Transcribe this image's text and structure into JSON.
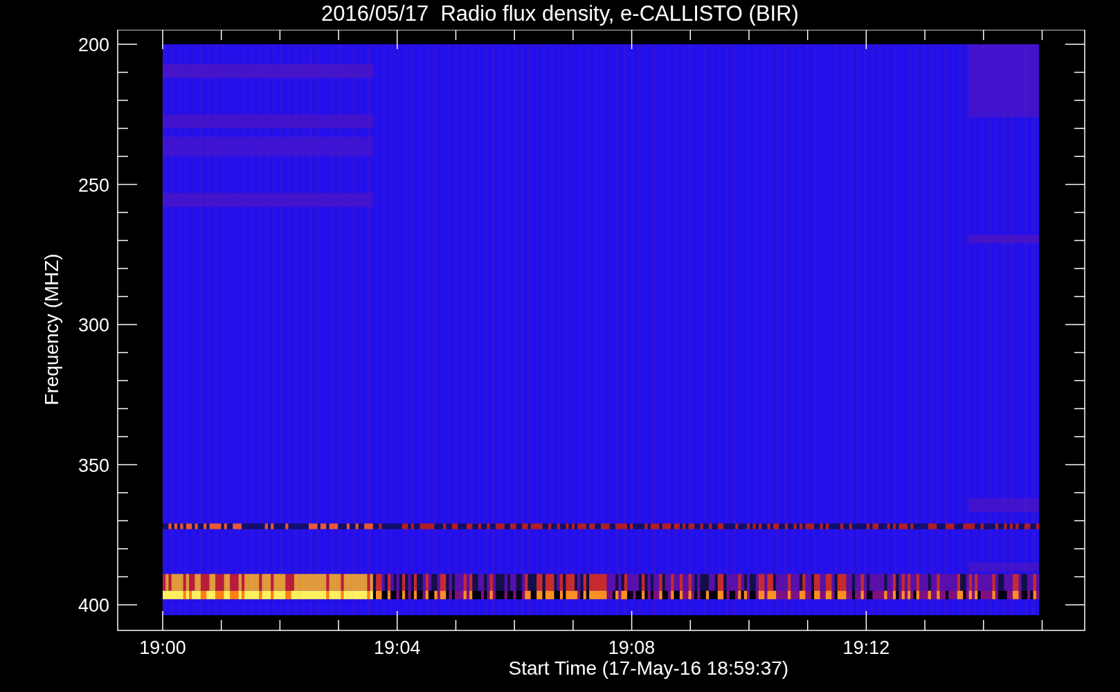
{
  "title": "2016/05/17  Radio flux density, e-CALLISTO (BIR)",
  "plot": {
    "xlabel": "Start Time (17-May-16 18:59:37)",
    "ylabel": "Frequency (MHZ)",
    "xticks": [
      "19:00",
      "19:04",
      "19:08",
      "19:12"
    ],
    "yticks": [
      "200",
      "250",
      "300",
      "350",
      "400"
    ]
  }
}
